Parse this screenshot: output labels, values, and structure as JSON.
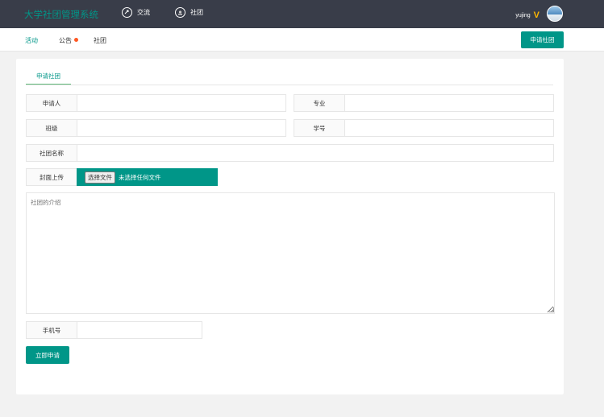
{
  "header": {
    "logo": "大学社团管理系统",
    "nav": [
      {
        "label": "交流",
        "icon": "chat-icon"
      },
      {
        "label": "社团",
        "icon": "group-icon"
      }
    ],
    "user": {
      "name": "yujing",
      "badge": "V"
    }
  },
  "subnav": {
    "items": [
      "活动",
      "公告",
      "社团"
    ],
    "apply_button": "申请社团"
  },
  "form": {
    "tab": "申请社团",
    "fields": {
      "applicant": "申请人",
      "major": "专业",
      "class": "班级",
      "student_id": "学号",
      "club_name": "社团名称",
      "cover": "封面上传",
      "phone": "手机号"
    },
    "file": {
      "button": "选择文件",
      "status": "未选择任何文件"
    },
    "intro_placeholder": "社团的介绍",
    "submit": "立即申请"
  },
  "colors": {
    "accent": "#009688",
    "header_bg": "#393d49",
    "badge": "#ff5722",
    "vip": "#ffb800"
  }
}
